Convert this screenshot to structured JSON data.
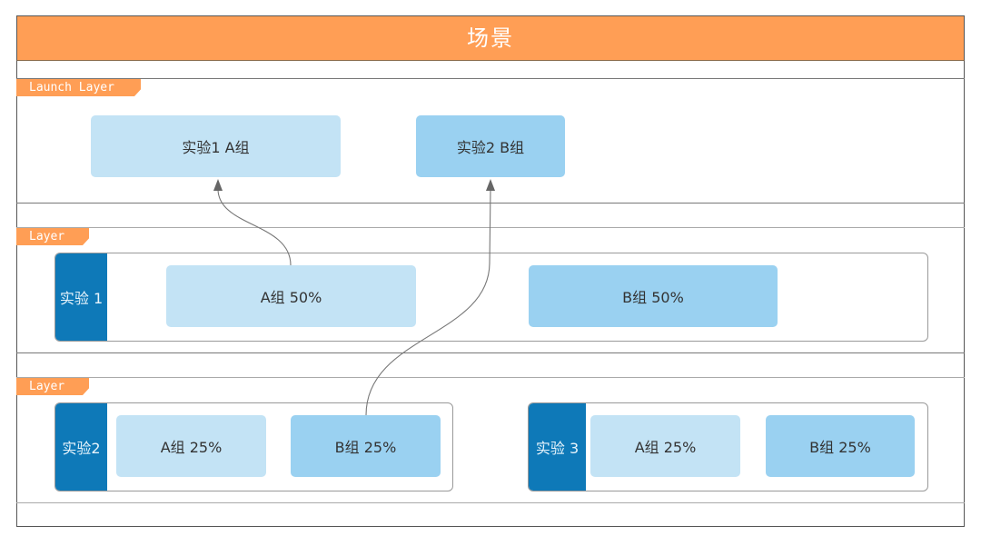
{
  "title": "场景",
  "colors": {
    "accent": "#FF9E55",
    "experiment": "#0E79B8",
    "group_a": "#C3E3F5",
    "group_b": "#9AD1F1"
  },
  "launch_layer": {
    "label": "Launch Layer",
    "items": [
      {
        "label": "实验1 A组"
      },
      {
        "label": "实验2 B组"
      }
    ]
  },
  "layers": [
    {
      "label": "Layer",
      "experiments": [
        {
          "name": "实验 1",
          "groups": [
            {
              "label": "A组 50%"
            },
            {
              "label": "B组 50%"
            }
          ]
        }
      ]
    },
    {
      "label": "Layer",
      "experiments": [
        {
          "name": "实验2",
          "groups": [
            {
              "label": "A组 25%"
            },
            {
              "label": "B组 25%"
            }
          ]
        },
        {
          "name": "实验 3",
          "groups": [
            {
              "label": "A组 25%"
            },
            {
              "label": "B组 25%"
            }
          ]
        }
      ]
    }
  ],
  "links": [
    {
      "from": "实验 1 / A组 50%",
      "to": "实验1 A组"
    },
    {
      "from": "实验2 / B组 25%",
      "to": "实验2 B组"
    }
  ]
}
